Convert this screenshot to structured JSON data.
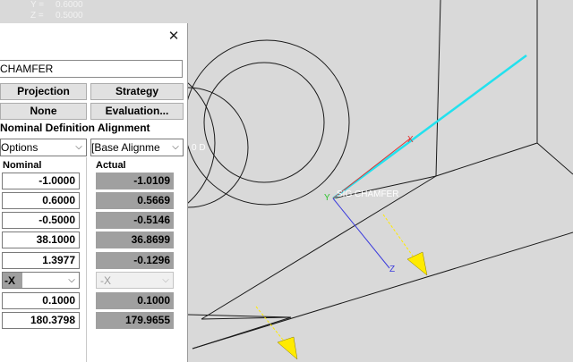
{
  "readout": {
    "y_label": "Y =",
    "y_value": "0.6000",
    "z_label": "Z =",
    "z_value": "0.5000"
  },
  "viewport": {
    "feature_label": "SIG CHAMFER",
    "axis_x": "X",
    "axis_y": "Y",
    "axis_z": "Z",
    "partial_text": "0 D",
    "colors": {
      "background": "#d9d9d9",
      "cyan": "#22e1ee",
      "yellow": "#ffeb00",
      "blue": "#3b3bdc",
      "red": "#e03030",
      "green": "#2ec42e"
    }
  },
  "panel": {
    "close_glyph": "✕",
    "name": "CHAMFER",
    "buttons": {
      "projection": "Projection",
      "strategy": "Strategy",
      "none": "None",
      "evaluation": "Evaluation..."
    },
    "section_title": "Nominal Definition Alignment",
    "options_combo": "Options",
    "alignment_combo": "[Base Alignme",
    "headers": {
      "nominal": "Nominal",
      "actual": "Actual"
    },
    "rows": [
      {
        "nominal": "-1.0000",
        "actual": "-1.0109"
      },
      {
        "nominal": "0.6000",
        "actual": "0.5669"
      },
      {
        "nominal": "-0.5000",
        "actual": "-0.5146"
      },
      {
        "nominal": "38.1000",
        "actual": "36.8699"
      },
      {
        "nominal": "1.3977",
        "actual": "-0.1296"
      },
      {
        "nominal": "0.1000",
        "actual": "0.1000"
      },
      {
        "nominal": "180.3798",
        "actual": "179.9655"
      }
    ],
    "dir_nominal": "-X",
    "dir_actual": "-X"
  }
}
